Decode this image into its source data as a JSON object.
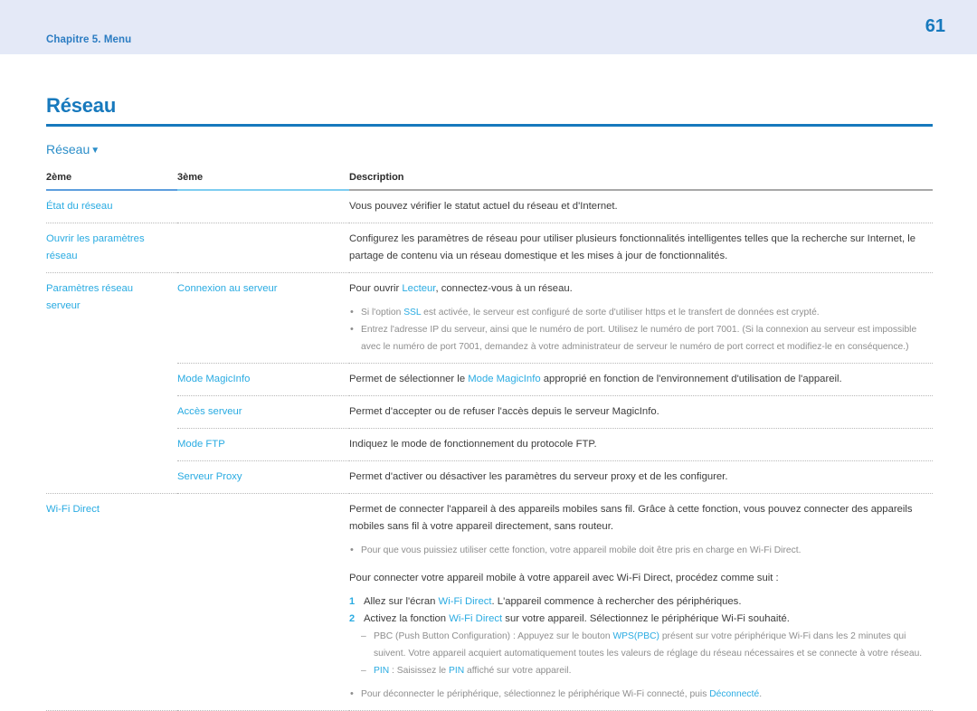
{
  "header": {
    "chapter": "Chapitre 5. Menu",
    "page_number": "61"
  },
  "section": {
    "title": "Réseau",
    "subsection": "Réseau",
    "subsection_caret": "▼"
  },
  "table": {
    "columns": [
      "2ème",
      "3ème",
      "Description"
    ],
    "rows": [
      {
        "col1": "État du réseau",
        "col2": "",
        "desc": "Vous pouvez vérifier le statut actuel du réseau et d'Internet."
      },
      {
        "col1_line1": "Ouvrir les paramètres",
        "col1_line2": "réseau",
        "col2": "",
        "desc": "Configurez les paramètres de réseau pour utiliser plusieurs fonctionnalités intelligentes telles que la recherche sur Internet, le partage de contenu via un réseau domestique et les mises à jour de fonctionnalités."
      },
      {
        "col1_line1": "Paramètres réseau",
        "col1_line2": "serveur",
        "col2": "Connexion au serveur",
        "desc_pre": "Pour ouvrir ",
        "desc_hl": "Lecteur",
        "desc_post": ", connectez-vous à un réseau.",
        "bullets": [
          {
            "pre": "Si l'option ",
            "hl": "SSL",
            "post": " est activée, le serveur est configuré de sorte d'utiliser https et le transfert de données est crypté."
          },
          {
            "pre": "",
            "hl": "",
            "post": "Entrez l'adresse IP du serveur, ainsi que le numéro de port. Utilisez le numéro de port 7001. (Si la connexion au serveur est impossible avec le numéro de port 7001, demandez à votre administrateur de serveur le numéro de port correct et modifiez-le en conséquence.)"
          }
        ]
      },
      {
        "col2": "Mode MagicInfo",
        "desc_pre": "Permet de sélectionner le ",
        "desc_hl": "Mode MagicInfo",
        "desc_post": " approprié en fonction de l'environnement d'utilisation de l'appareil."
      },
      {
        "col2": "Accès serveur",
        "desc": "Permet d'accepter ou de refuser l'accès depuis le serveur MagicInfo."
      },
      {
        "col2": "Mode FTP",
        "desc": "Indiquez le mode de fonctionnement du protocole FTP."
      },
      {
        "col2": "Serveur Proxy",
        "desc": "Permet d'activer ou désactiver les paramètres du serveur proxy et de les configurer."
      }
    ],
    "wifi_row": {
      "col1": "Wi-Fi Direct",
      "intro": "Permet de connecter l'appareil à des appareils mobiles sans fil. Grâce à cette fonction, vous pouvez connecter des appareils mobiles sans fil à votre appareil directement, sans routeur.",
      "note": "Pour que vous puissiez utiliser cette fonction, votre appareil mobile doit être pris en charge en Wi-Fi Direct.",
      "lead": "Pour connecter votre appareil mobile à votre appareil avec Wi-Fi Direct, procédez comme suit :",
      "step1_pre": "Allez sur l'écran ",
      "step1_hl": "Wi-Fi Direct",
      "step1_post": ". L'appareil commence à rechercher des périphériques.",
      "step2_pre": "Activez la fonction ",
      "step2_hl": "Wi-Fi Direct",
      "step2_post": " sur votre appareil. Sélectionnez le périphérique Wi-Fi souhaité.",
      "dash1_pre": "PBC (Push Button Configuration) : Appuyez sur le bouton ",
      "dash1_hl": "WPS(PBC)",
      "dash1_post": " présent sur votre périphérique Wi-Fi dans les 2 minutes qui suivent. Votre appareil acquiert automatiquement toutes les valeurs de réglage du réseau nécessaires et se connecte à votre réseau.",
      "dash2_hl1": "PIN",
      "dash2_mid": " : Saisissez le ",
      "dash2_hl2": "PIN",
      "dash2_post": " affiché sur votre appareil.",
      "final_pre": "Pour déconnecter le périphérique, sélectionnez le périphérique Wi-Fi connecté, puis ",
      "final_hl": "Déconnecté",
      "final_post": "."
    }
  },
  "colors": {
    "header_band": "#e4e9f7",
    "title_blue": "#1779bd",
    "link_cyan": "#29abe2",
    "body_gray": "#3c3c3c",
    "note_gray": "#8e8e8e"
  }
}
